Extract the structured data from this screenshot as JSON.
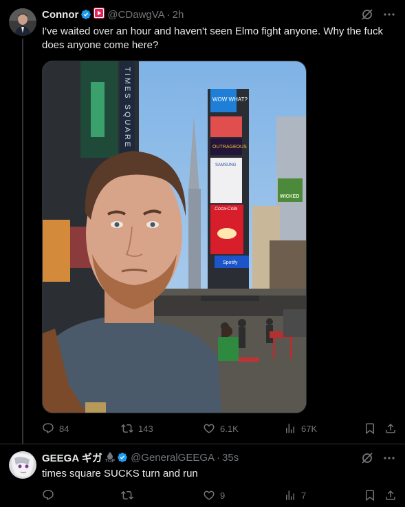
{
  "tweet1": {
    "name": "Connor",
    "handle": "@CDawgVA",
    "dot": "·",
    "time": "2h",
    "text": "I've waited over an hour and haven't seen Elmo fight anyone. Why the fuck does anyone come here?",
    "media": {
      "sign_vertical": "TIMES SQUARE",
      "billboard_top": "WOW WHAT?",
      "billboard_middle": "OUTRAGEOUS",
      "billboard_samsung": "SAMSUNG",
      "billboard_cola": "Coca-Cola",
      "billboard_spotify": "Spotify",
      "billboard_wicked": "WICKED"
    },
    "stats": {
      "replies": "84",
      "reposts": "143",
      "likes": "6.1K",
      "views": "67K"
    }
  },
  "tweet2": {
    "name": "GEEGA ギガ",
    "badge_label": "TOP",
    "handle": "@GeneralGEEGA",
    "dot": "·",
    "time": "35s",
    "text": "times square SUCKS turn and run",
    "stats": {
      "replies": "",
      "reposts": "",
      "likes": "9",
      "views": "7"
    }
  },
  "colors": {
    "verified": "#1d9bf0",
    "muted": "#71767b",
    "text": "#e7e9ea",
    "bg": "#000000",
    "affiliate": "#e0245e"
  }
}
